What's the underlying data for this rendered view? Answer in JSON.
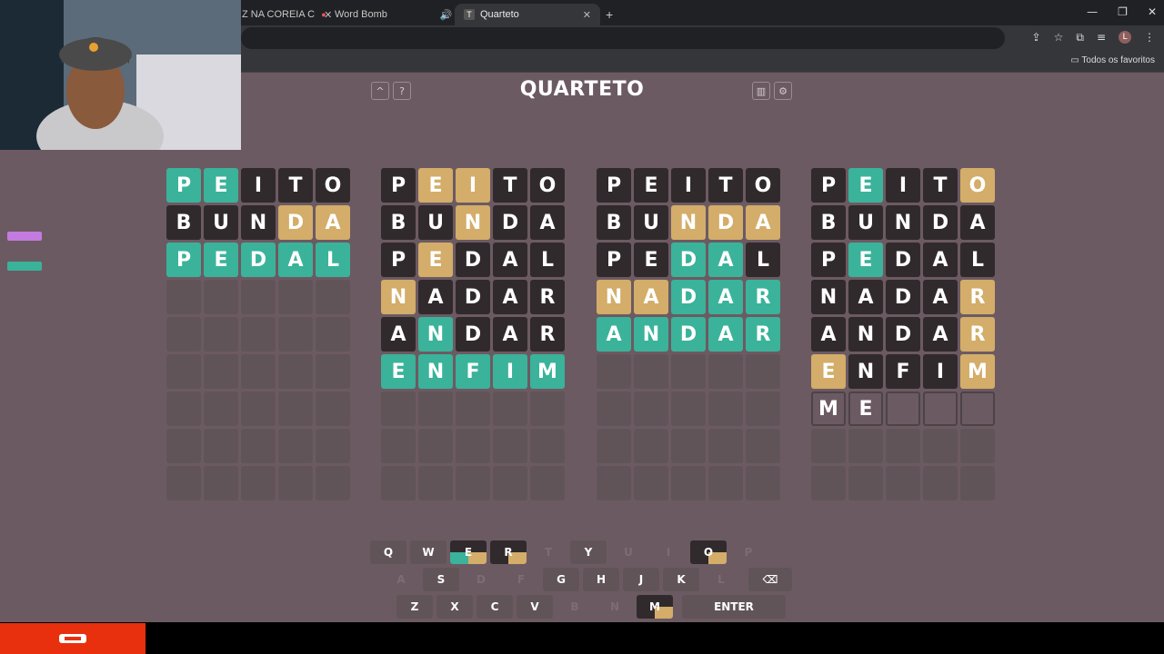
{
  "browser": {
    "tabs": [
      {
        "label": "Z NA COREIA C",
        "icon": "video-icon",
        "active": false
      },
      {
        "label": "Word Bomb",
        "icon": "bomb-icon",
        "active": false
      },
      {
        "label": "Quarteto",
        "icon": "quarteto-icon",
        "active": true
      }
    ],
    "bookmarks_label": "Todos os favoritos",
    "avatar_letter": "L"
  },
  "game": {
    "title": "QUARTETO",
    "top_buttons": {
      "collapse": "^",
      "help": "?",
      "stats": "stats-icon",
      "settings": "gear-icon"
    }
  },
  "boards": [
    {
      "rows": [
        {
          "letters": [
            "P",
            "E",
            "I",
            "T",
            "O"
          ],
          "states": [
            "g",
            "g",
            "d",
            "d",
            "d"
          ]
        },
        {
          "letters": [
            "B",
            "U",
            "N",
            "D",
            "A"
          ],
          "states": [
            "d",
            "d",
            "d",
            "y",
            "y"
          ]
        },
        {
          "letters": [
            "P",
            "E",
            "D",
            "A",
            "L"
          ],
          "states": [
            "g",
            "g",
            "g",
            "g",
            "g"
          ]
        }
      ],
      "typed": [],
      "total_rows": 9
    },
    {
      "rows": [
        {
          "letters": [
            "P",
            "E",
            "I",
            "T",
            "O"
          ],
          "states": [
            "d",
            "y",
            "y",
            "d",
            "d"
          ]
        },
        {
          "letters": [
            "B",
            "U",
            "N",
            "D",
            "A"
          ],
          "states": [
            "d",
            "d",
            "y",
            "d",
            "d"
          ]
        },
        {
          "letters": [
            "P",
            "E",
            "D",
            "A",
            "L"
          ],
          "states": [
            "d",
            "y",
            "d",
            "d",
            "d"
          ]
        },
        {
          "letters": [
            "N",
            "A",
            "D",
            "A",
            "R"
          ],
          "states": [
            "y",
            "d",
            "d",
            "d",
            "d"
          ]
        },
        {
          "letters": [
            "A",
            "N",
            "D",
            "A",
            "R"
          ],
          "states": [
            "d",
            "g",
            "d",
            "d",
            "d"
          ]
        },
        {
          "letters": [
            "E",
            "N",
            "F",
            "I",
            "M"
          ],
          "states": [
            "g",
            "g",
            "g",
            "g",
            "g"
          ]
        }
      ],
      "typed": [],
      "total_rows": 9
    },
    {
      "rows": [
        {
          "letters": [
            "P",
            "E",
            "I",
            "T",
            "O"
          ],
          "states": [
            "d",
            "d",
            "d",
            "d",
            "d"
          ]
        },
        {
          "letters": [
            "B",
            "U",
            "N",
            "D",
            "A"
          ],
          "states": [
            "d",
            "d",
            "y",
            "y",
            "y"
          ]
        },
        {
          "letters": [
            "P",
            "E",
            "D",
            "A",
            "L"
          ],
          "states": [
            "d",
            "d",
            "g",
            "g",
            "d"
          ]
        },
        {
          "letters": [
            "N",
            "A",
            "D",
            "A",
            "R"
          ],
          "states": [
            "y",
            "y",
            "g",
            "g",
            "g"
          ]
        },
        {
          "letters": [
            "A",
            "N",
            "D",
            "A",
            "R"
          ],
          "states": [
            "g",
            "g",
            "g",
            "g",
            "g"
          ]
        }
      ],
      "typed": [],
      "total_rows": 9
    },
    {
      "rows": [
        {
          "letters": [
            "P",
            "E",
            "I",
            "T",
            "O"
          ],
          "states": [
            "d",
            "g",
            "d",
            "d",
            "y"
          ]
        },
        {
          "letters": [
            "B",
            "U",
            "N",
            "D",
            "A"
          ],
          "states": [
            "d",
            "d",
            "d",
            "d",
            "d"
          ]
        },
        {
          "letters": [
            "P",
            "E",
            "D",
            "A",
            "L"
          ],
          "states": [
            "d",
            "g",
            "d",
            "d",
            "d"
          ]
        },
        {
          "letters": [
            "N",
            "A",
            "D",
            "A",
            "R"
          ],
          "states": [
            "d",
            "d",
            "d",
            "d",
            "y"
          ]
        },
        {
          "letters": [
            "A",
            "N",
            "D",
            "A",
            "R"
          ],
          "states": [
            "d",
            "d",
            "d",
            "d",
            "y"
          ]
        },
        {
          "letters": [
            "E",
            "N",
            "F",
            "I",
            "M"
          ],
          "states": [
            "y",
            "d",
            "d",
            "d",
            "y"
          ]
        }
      ],
      "typed": [
        "M",
        "E"
      ],
      "total_rows": 9
    }
  ],
  "keyboard": {
    "rows": [
      [
        {
          "k": "Q",
          "s": "n"
        },
        {
          "k": "W",
          "s": "n"
        },
        {
          "k": "E",
          "s": "m",
          "q": [
            "d",
            "d",
            "g",
            "y"
          ]
        },
        {
          "k": "R",
          "s": "m",
          "q": [
            "d",
            "d",
            "d",
            "y"
          ]
        },
        {
          "k": "T",
          "s": "u"
        },
        {
          "k": "Y",
          "s": "n"
        },
        {
          "k": "U",
          "s": "u"
        },
        {
          "k": "I",
          "s": "u"
        },
        {
          "k": "O",
          "s": "m",
          "q": [
            "d",
            "d",
            "d",
            "y"
          ]
        },
        {
          "k": "P",
          "s": "u"
        }
      ],
      [
        {
          "k": "A",
          "s": "u"
        },
        {
          "k": "S",
          "s": "n"
        },
        {
          "k": "D",
          "s": "u"
        },
        {
          "k": "F",
          "s": "u"
        },
        {
          "k": "G",
          "s": "n"
        },
        {
          "k": "H",
          "s": "n"
        },
        {
          "k": "J",
          "s": "n"
        },
        {
          "k": "K",
          "s": "n"
        },
        {
          "k": "L",
          "s": "u"
        },
        {
          "k": "⌫",
          "s": "n",
          "w": "back"
        }
      ],
      [
        {
          "k": "Z",
          "s": "n"
        },
        {
          "k": "X",
          "s": "n"
        },
        {
          "k": "C",
          "s": "n"
        },
        {
          "k": "V",
          "s": "n"
        },
        {
          "k": "B",
          "s": "u"
        },
        {
          "k": "N",
          "s": "u"
        },
        {
          "k": "M",
          "s": "m",
          "q": [
            "d",
            "d",
            "d",
            "y"
          ]
        },
        {
          "k": "ENTER",
          "s": "n",
          "w": "enter"
        }
      ]
    ]
  },
  "colors": {
    "green": "#3ab39a",
    "yellow": "#d3ad69",
    "dark": "#312a2c",
    "page_bg": "#6c5a62",
    "stream_red": "#e8300f"
  }
}
